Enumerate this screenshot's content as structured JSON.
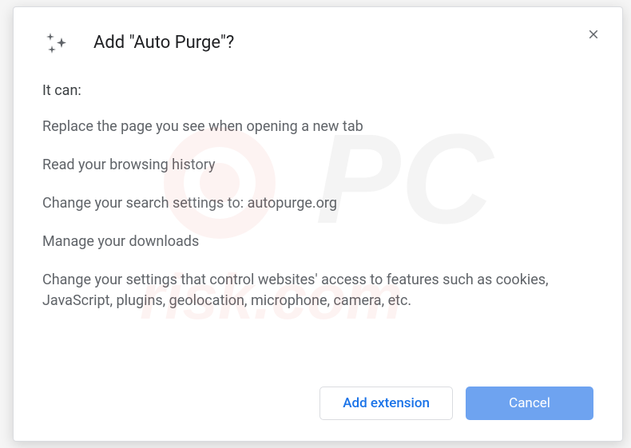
{
  "dialog": {
    "title": "Add \"Auto Purge\"?",
    "intro": "It can:",
    "permissions": [
      "Replace the page you see when opening a new tab",
      "Read your browsing history",
      "Change your search settings to: autopurge.org",
      "Manage your downloads",
      "Change your settings that control websites' access to features such as cookies, JavaScript, plugins, geolocation, microphone, camera, etc."
    ],
    "buttons": {
      "add": "Add extension",
      "cancel": "Cancel"
    }
  }
}
